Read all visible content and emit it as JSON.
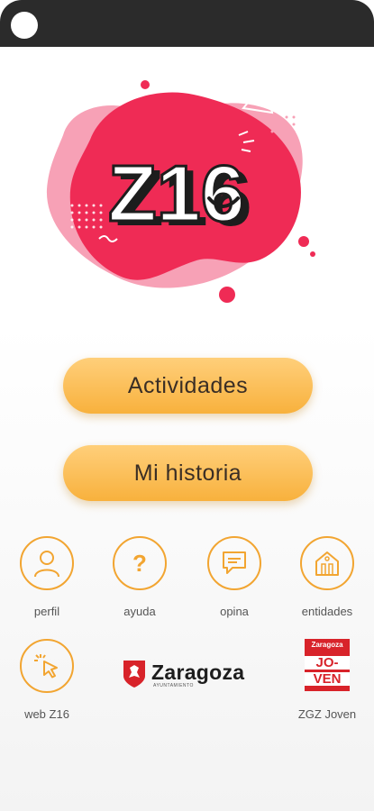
{
  "app": {
    "logo_text": "Z16"
  },
  "main_buttons": [
    {
      "label": "Actividades"
    },
    {
      "label": "Mi historia"
    }
  ],
  "icons_row1": [
    {
      "icon": "person-icon",
      "label": "perfil"
    },
    {
      "icon": "question-icon",
      "label": "ayuda"
    },
    {
      "icon": "chat-bubble-icon",
      "label": "opina"
    },
    {
      "icon": "building-icon",
      "label": "entidades"
    }
  ],
  "icons_row2": [
    {
      "icon": "cursor-click-icon",
      "label": "web Z16"
    },
    {
      "icon": "zaragoza-logo",
      "label": "Zaragoza",
      "sub": "AYUNTAMIENTO"
    },
    {
      "icon": "zgz-joven-logo",
      "label": "ZGZ Joven",
      "badge_top": "Zaragoza",
      "badge_jo": "JO-",
      "badge_ven": "VEN"
    }
  ],
  "colors": {
    "accent": "#f2a531",
    "button": "#fbbf57",
    "logo_pink": "#ef2b55",
    "topbar": "#2b2b2b"
  }
}
